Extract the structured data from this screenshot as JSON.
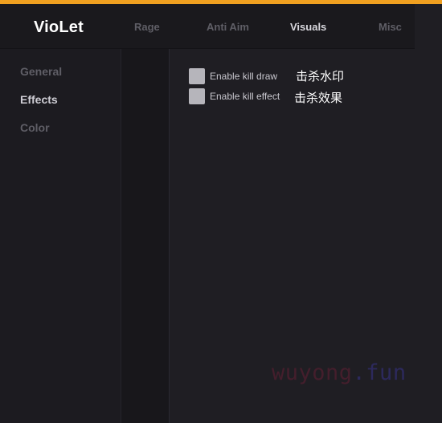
{
  "app": {
    "title": "VioLet",
    "accent_color": "#f0a020"
  },
  "tabs": [
    {
      "label": "Rage",
      "active": false
    },
    {
      "label": "Anti Aim",
      "active": false
    },
    {
      "label": "Visuals",
      "active": true
    },
    {
      "label": "Misc",
      "active": false
    }
  ],
  "sidebar": {
    "items": [
      {
        "label": "General",
        "active": false
      },
      {
        "label": "Effects",
        "active": true
      },
      {
        "label": "Color",
        "active": false
      }
    ]
  },
  "options": [
    {
      "label": "Enable kill draw",
      "checked": false,
      "annotation": "击杀水印"
    },
    {
      "label": "Enable kill effect",
      "checked": false,
      "annotation": "击杀效果"
    }
  ],
  "watermark": {
    "name": "wuyong",
    "tld": ".fun"
  }
}
